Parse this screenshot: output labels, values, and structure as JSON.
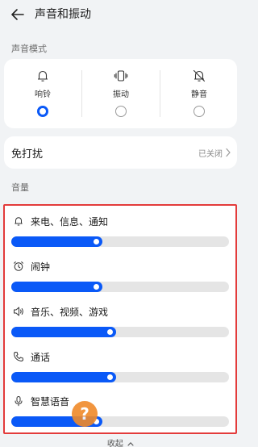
{
  "header": {
    "title": "声音和振动"
  },
  "sound_mode": {
    "section_label": "声音模式",
    "options": [
      {
        "label": "响铃",
        "icon": "bell-icon",
        "selected": true
      },
      {
        "label": "振动",
        "icon": "vibrate-icon",
        "selected": false
      },
      {
        "label": "静音",
        "icon": "bell-off-icon",
        "selected": false
      }
    ]
  },
  "do_not_disturb": {
    "label": "免打扰",
    "value": "已关闭"
  },
  "volume": {
    "section_label": "音量",
    "items": [
      {
        "name": "来电、信息、通知",
        "icon": "bell-icon",
        "level": 0.42
      },
      {
        "name": "闹钟",
        "icon": "alarm-clock-icon",
        "level": 0.42
      },
      {
        "name": "音乐、视频、游戏",
        "icon": "speaker-icon",
        "level": 0.48
      },
      {
        "name": "通话",
        "icon": "phone-icon",
        "level": 0.48
      },
      {
        "name": "智慧语音",
        "icon": "microphone-icon",
        "level": 0.42
      }
    ]
  },
  "footer": {
    "collapse_label": "收起"
  },
  "overlay": {
    "badge_text": "?"
  },
  "colors": {
    "accent": "#0a59f7",
    "highlight_border": "#e33b3b",
    "badge": "#f08a2a"
  }
}
